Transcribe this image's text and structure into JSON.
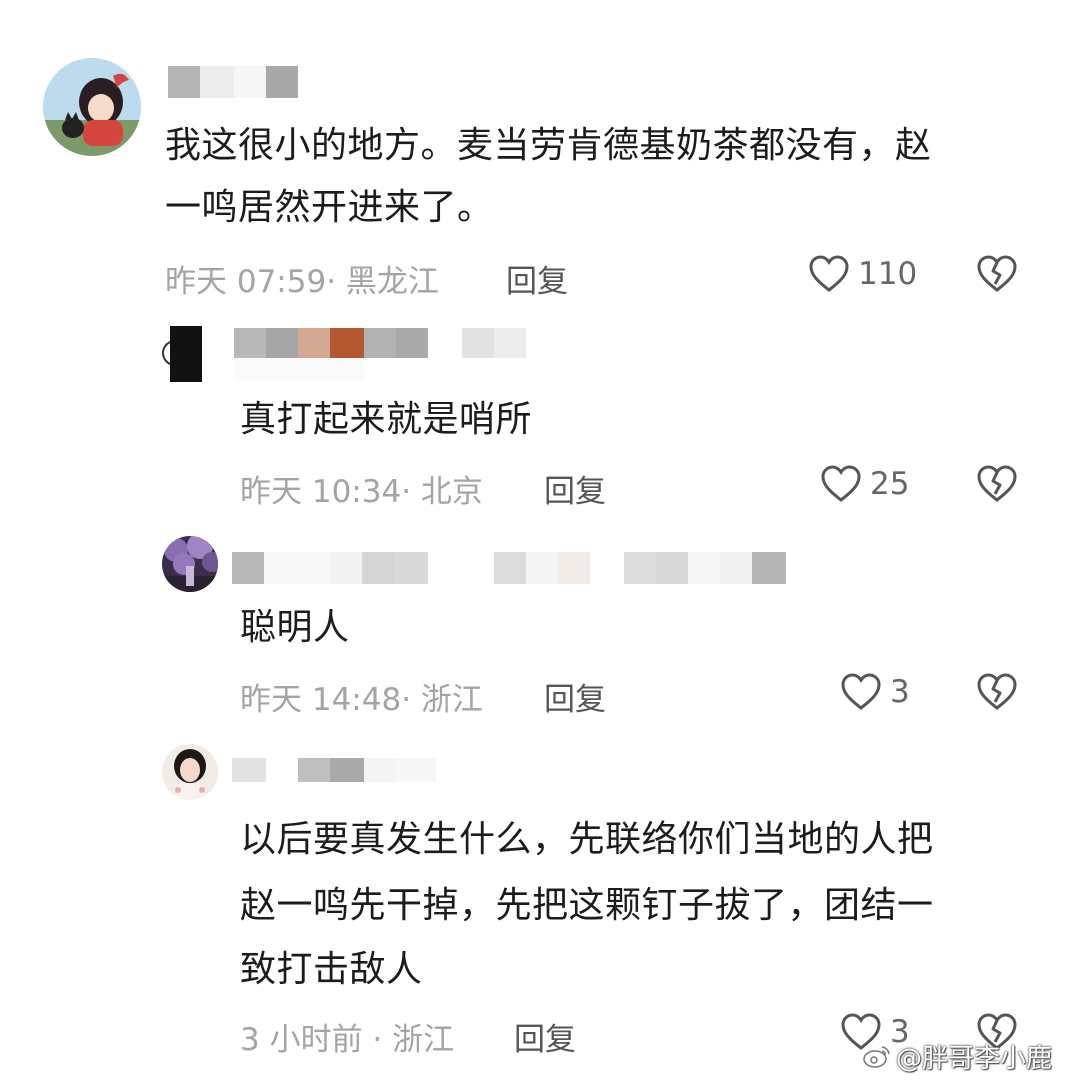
{
  "comments": [
    {
      "text_lines": [
        "我这很小的地方。麦当劳肯德基奶茶都没有，赵",
        "一鸣居然开进来了。"
      ],
      "meta": "昨天 07:59· 黑龙江",
      "reply_label": "回复",
      "likes": "110"
    },
    {
      "text_lines": [
        "真打起来就是哨所"
      ],
      "meta": "昨天 10:34· 北京",
      "reply_label": "回复",
      "likes": "25"
    },
    {
      "text_lines": [
        "聪明人"
      ],
      "meta": "昨天 14:48· 浙江",
      "reply_label": "回复",
      "likes": "3"
    },
    {
      "text_lines": [
        "以后要真发生什么，先联络你们当地的人把",
        "赵一鸣先干掉，先把这颗钉子拔了，团结一",
        "致打击敌人"
      ],
      "meta": "3 小时前 · 浙江",
      "reply_label": "回复",
      "likes": "3"
    }
  ],
  "watermark": "@胖哥李小鹿",
  "icons": {
    "like": "heart-outline-icon",
    "dislike": "broken-heart-icon",
    "watermark_logo": "weibo-logo-icon"
  },
  "colors": {
    "text": "#1c1c1c",
    "meta": "#a4a4a4",
    "reply": "#555555",
    "icon": "#555555"
  }
}
